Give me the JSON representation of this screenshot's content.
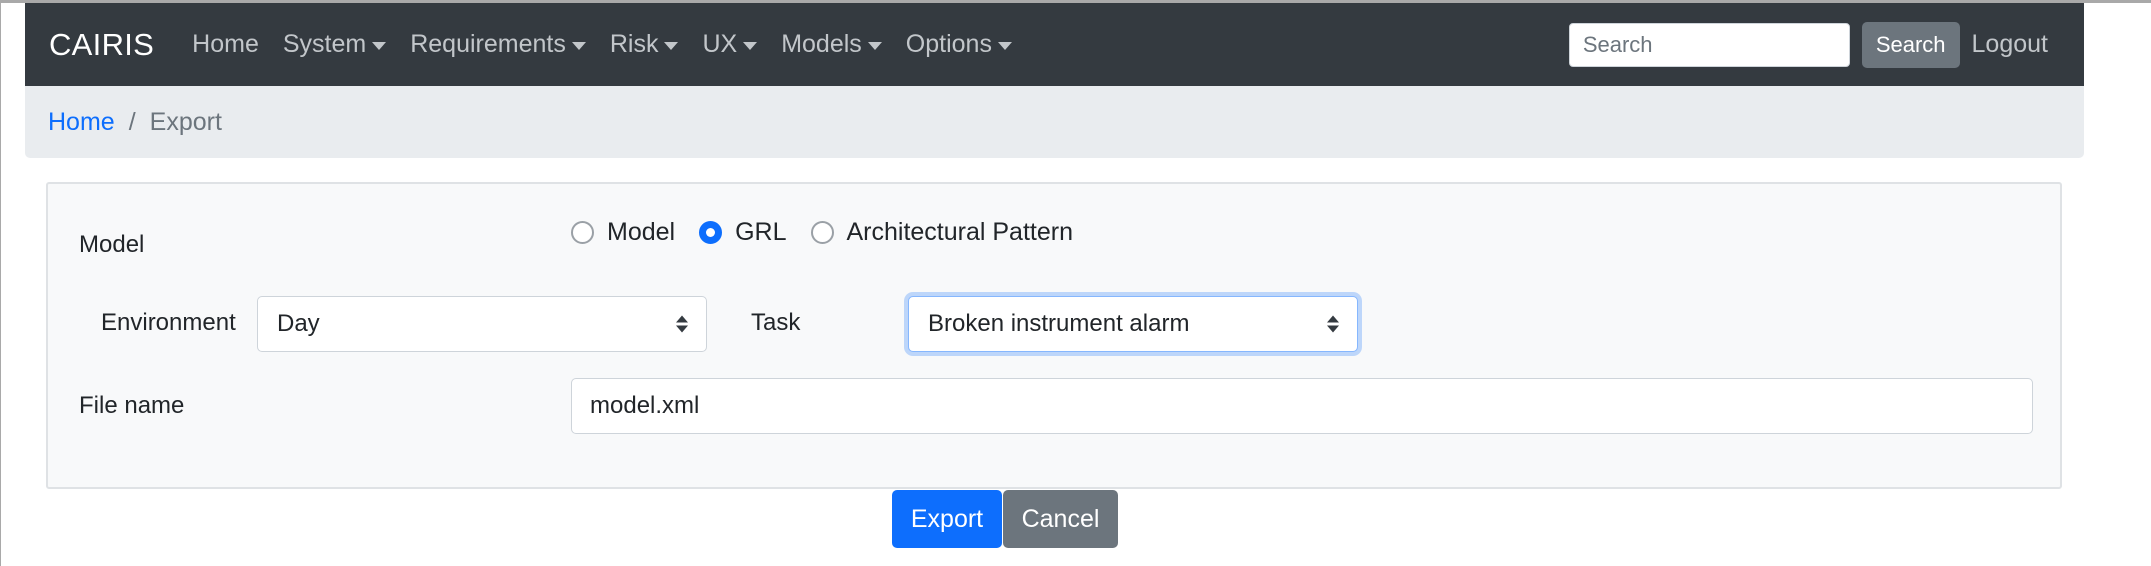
{
  "navbar": {
    "brand": "CAIRIS",
    "items": [
      {
        "label": "Home",
        "dropdown": false
      },
      {
        "label": "System",
        "dropdown": true
      },
      {
        "label": "Requirements",
        "dropdown": true
      },
      {
        "label": "Risk",
        "dropdown": true
      },
      {
        "label": "UX",
        "dropdown": true
      },
      {
        "label": "Models",
        "dropdown": true
      },
      {
        "label": "Options",
        "dropdown": true
      }
    ],
    "search_placeholder": "Search",
    "search_button": "Search",
    "logout": "Logout"
  },
  "breadcrumb": {
    "home": "Home",
    "separator": "/",
    "current": "Export"
  },
  "form": {
    "model_label": "Model",
    "radio_options": [
      {
        "label": "Model",
        "checked": false
      },
      {
        "label": "GRL",
        "checked": true
      },
      {
        "label": "Architectural Pattern",
        "checked": false
      }
    ],
    "environment_label": "Environment",
    "environment_value": "Day",
    "task_label": "Task",
    "task_value": "Broken instrument alarm",
    "filename_label": "File name",
    "filename_value": "model.xml"
  },
  "actions": {
    "export": "Export",
    "cancel": "Cancel"
  },
  "colors": {
    "navbar_bg": "#343a40",
    "primary": "#0d6efd",
    "secondary": "#6c757d",
    "breadcrumb_bg": "#e9ecef"
  }
}
